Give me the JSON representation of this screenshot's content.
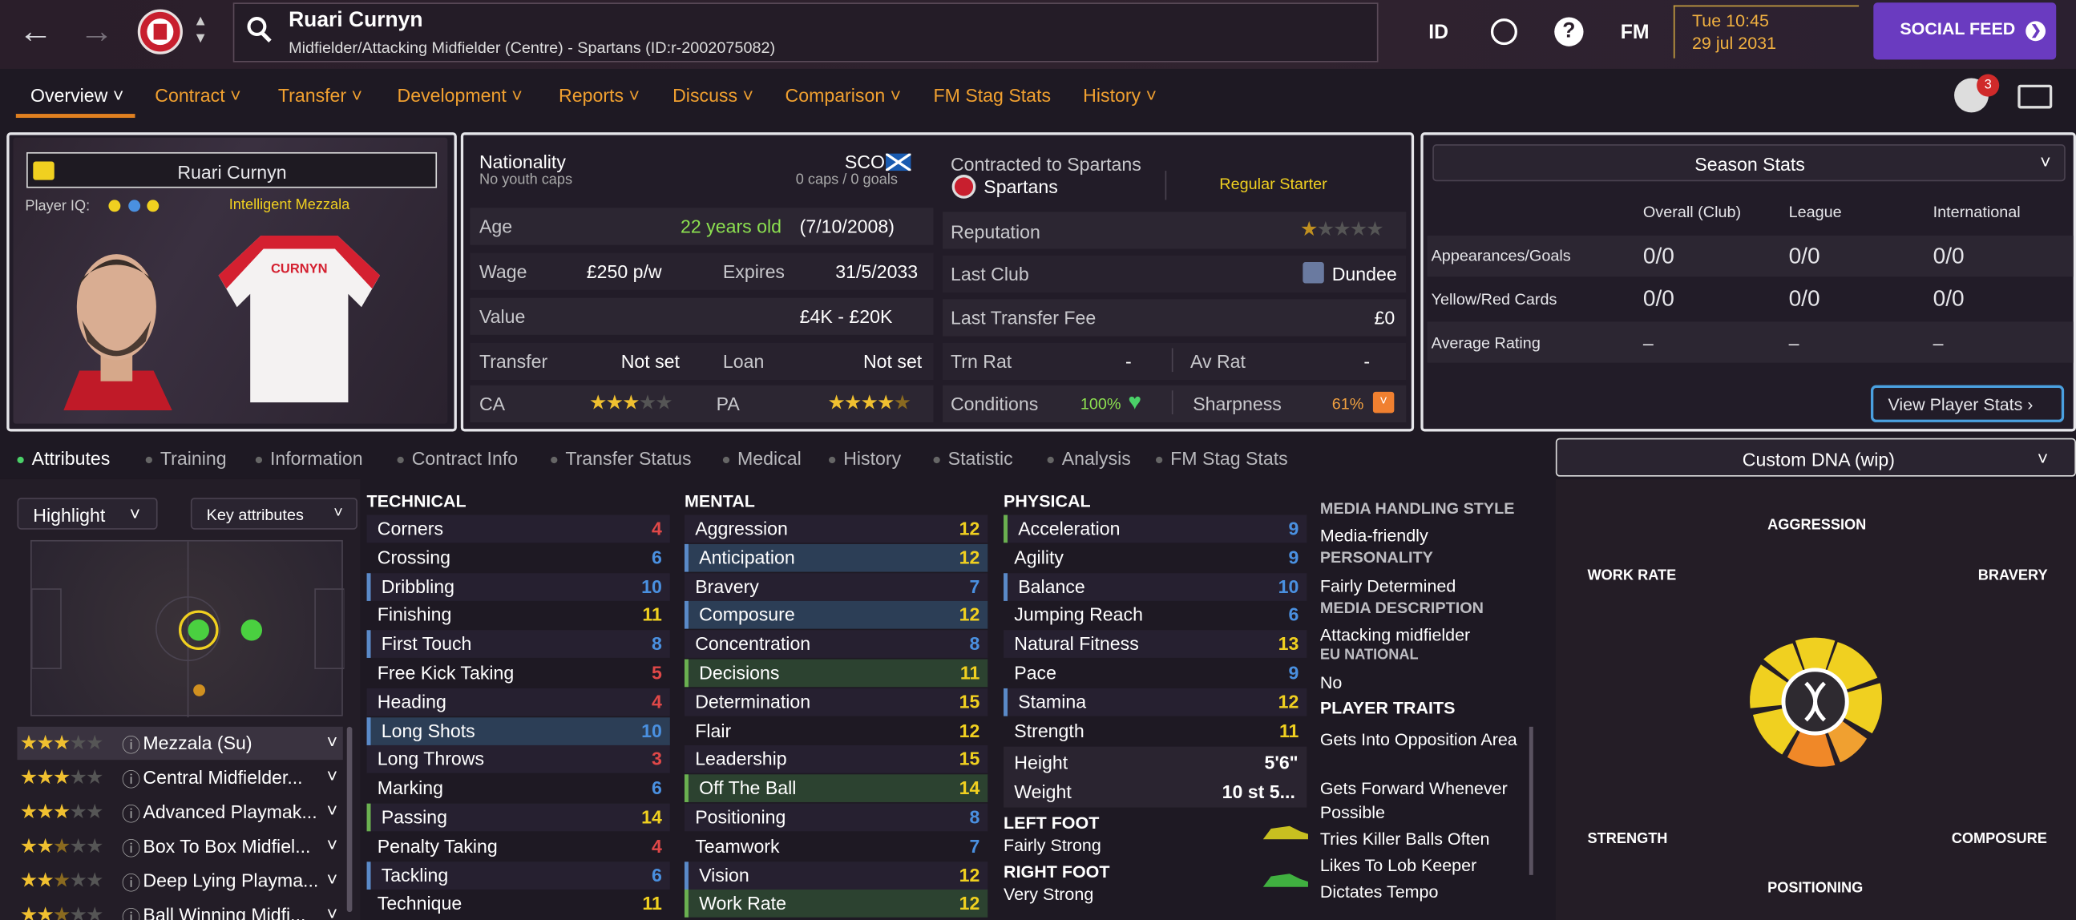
{
  "header": {
    "player_name": "Ruari Curnyn",
    "player_subtitle": "Midfielder/Attacking Midfielder (Centre) - Spartans (ID:r-2002075082)",
    "icon_id": "ID",
    "icon_fm": "FM",
    "time": "Tue 10:45",
    "date": "29 jul 2031",
    "social_feed": "SOCIAL FEED",
    "notification_count": "3"
  },
  "tabs": [
    "Overview",
    "Contract",
    "Transfer",
    "Development",
    "Reports",
    "Discuss",
    "Comparison",
    "FM Stag Stats",
    "History"
  ],
  "card": {
    "name": "Ruari Curnyn",
    "iq_label": "Player IQ:",
    "role_label": "Intelligent  Mezzala",
    "shirt_text": "CURNYN"
  },
  "info": {
    "nationality_label": "Nationality",
    "nationality_code": "SCO",
    "youth_caps": "No youth caps",
    "caps": "0 caps / 0 goals",
    "age_label": "Age",
    "age_value": "22 years old",
    "dob": "(7/10/2008)",
    "wage_label": "Wage",
    "wage_value": "£250 p/w",
    "expires_label": "Expires",
    "expires_value": "31/5/2033",
    "value_label": "Value",
    "value_value": "£4K - £20K",
    "transfer_label": "Transfer",
    "transfer_value": "Not set",
    "loan_label": "Loan",
    "loan_value": "Not set",
    "ca_label": "CA",
    "pa_label": "PA",
    "ca_stars": 3,
    "pa_stars": 4.5
  },
  "contract": {
    "contracted_label": "Contracted to Spartans",
    "club": "Spartans",
    "status": "Regular Starter",
    "reputation_label": "Reputation",
    "reputation_stars": 0.5,
    "last_club_label": "Last Club",
    "last_club": "Dundee",
    "fee_label": "Last Transfer Fee",
    "fee_value": "£0",
    "trn_label": "Trn Rat",
    "trn_value": "-",
    "av_label": "Av Rat",
    "av_value": "-",
    "conditions_label": "Conditions",
    "conditions_value": "100%",
    "sharpness_label": "Sharpness",
    "sharpness_value": "61%"
  },
  "season": {
    "title": "Season Stats",
    "columns": [
      "Overall (Club)",
      "League",
      "International"
    ],
    "rows": [
      {
        "label": "Appearances/Goals",
        "values": [
          "0/0",
          "0/0",
          "0/0"
        ]
      },
      {
        "label": "Yellow/Red Cards",
        "values": [
          "0/0",
          "0/0",
          "0/0"
        ]
      },
      {
        "label": "Average Rating",
        "values": [
          "–",
          "–",
          "–"
        ]
      }
    ],
    "view_button": "View Player Stats ›"
  },
  "subtabs": [
    "Attributes",
    "Training",
    "Information",
    "Contract Info",
    "Transfer Status",
    "Medical",
    "History",
    "Statistic",
    "Analysis",
    "FM Stag Stats"
  ],
  "dna_title": "Custom DNA (wip)",
  "controls": {
    "highlight": "Highlight",
    "key_attributes": "Key attributes"
  },
  "roles": [
    {
      "label": "Mezzala (Su)",
      "stars": 3
    },
    {
      "label": "Central Midfielder...",
      "stars": 3
    },
    {
      "label": "Advanced Playmak...",
      "stars": 3
    },
    {
      "label": "Box To Box Midfiel...",
      "stars": 2.5
    },
    {
      "label": "Deep Lying Playma...",
      "stars": 2.5
    },
    {
      "label": "Ball Winning Midfi...",
      "stars": 2.5
    }
  ],
  "technical": {
    "title": "TECHNICAL",
    "items": [
      [
        "Corners",
        "4"
      ],
      [
        "Crossing",
        "6"
      ],
      [
        "Dribbling",
        "10"
      ],
      [
        "Finishing",
        "11"
      ],
      [
        "First Touch",
        "8"
      ],
      [
        "Free Kick Taking",
        "5"
      ],
      [
        "Heading",
        "4"
      ],
      [
        "Long Shots",
        "10"
      ],
      [
        "Long Throws",
        "3"
      ],
      [
        "Marking",
        "6"
      ],
      [
        "Passing",
        "14"
      ],
      [
        "Penalty Taking",
        "4"
      ],
      [
        "Tackling",
        "6"
      ],
      [
        "Technique",
        "11"
      ]
    ]
  },
  "mental": {
    "title": "MENTAL",
    "items": [
      [
        "Aggression",
        "12"
      ],
      [
        "Anticipation",
        "12"
      ],
      [
        "Bravery",
        "7"
      ],
      [
        "Composure",
        "12"
      ],
      [
        "Concentration",
        "8"
      ],
      [
        "Decisions",
        "11"
      ],
      [
        "Determination",
        "15"
      ],
      [
        "Flair",
        "12"
      ],
      [
        "Leadership",
        "15"
      ],
      [
        "Off The Ball",
        "14"
      ],
      [
        "Positioning",
        "8"
      ],
      [
        "Teamwork",
        "7"
      ],
      [
        "Vision",
        "12"
      ],
      [
        "Work Rate",
        "12"
      ]
    ]
  },
  "physical": {
    "title": "PHYSICAL",
    "items": [
      [
        "Acceleration",
        "9"
      ],
      [
        "Agility",
        "9"
      ],
      [
        "Balance",
        "10"
      ],
      [
        "Jumping Reach",
        "6"
      ],
      [
        "Natural Fitness",
        "13"
      ],
      [
        "Pace",
        "9"
      ],
      [
        "Stamina",
        "12"
      ],
      [
        "Strength",
        "11"
      ]
    ],
    "height_label": "Height",
    "height": "5'6\"",
    "weight_label": "Weight",
    "weight": "10 st 5...",
    "left_foot_label": "LEFT FOOT",
    "left_foot": "Fairly Strong",
    "right_foot_label": "RIGHT FOOT",
    "right_foot": "Very Strong"
  },
  "side": {
    "media_style_label": "MEDIA HANDLING STYLE",
    "media_style": "Media-friendly",
    "personality_label": "PERSONALITY",
    "personality": "Fairly Determined",
    "media_desc_label": "MEDIA DESCRIPTION",
    "media_desc": "Attacking midfielder",
    "eu_label": "EU NATIONAL",
    "eu": "No",
    "traits_label": "PLAYER TRAITS",
    "traits": [
      "Gets Into Opposition Area",
      "Gets Forward Whenever Possible",
      "Tries Killer Balls Often",
      "Likes To Lob Keeper",
      "Dictates Tempo"
    ]
  },
  "dna": {
    "labels": [
      "AGGRESSION",
      "WORK RATE",
      "BRAVERY",
      "STRENGTH",
      "COMPOSURE",
      "POSITIONING"
    ]
  },
  "colors": {
    "accent": "#f0a030",
    "social": "#6a3bc0",
    "low": "#e04848",
    "mid": "#4a90e0",
    "good": "#f0d020"
  }
}
